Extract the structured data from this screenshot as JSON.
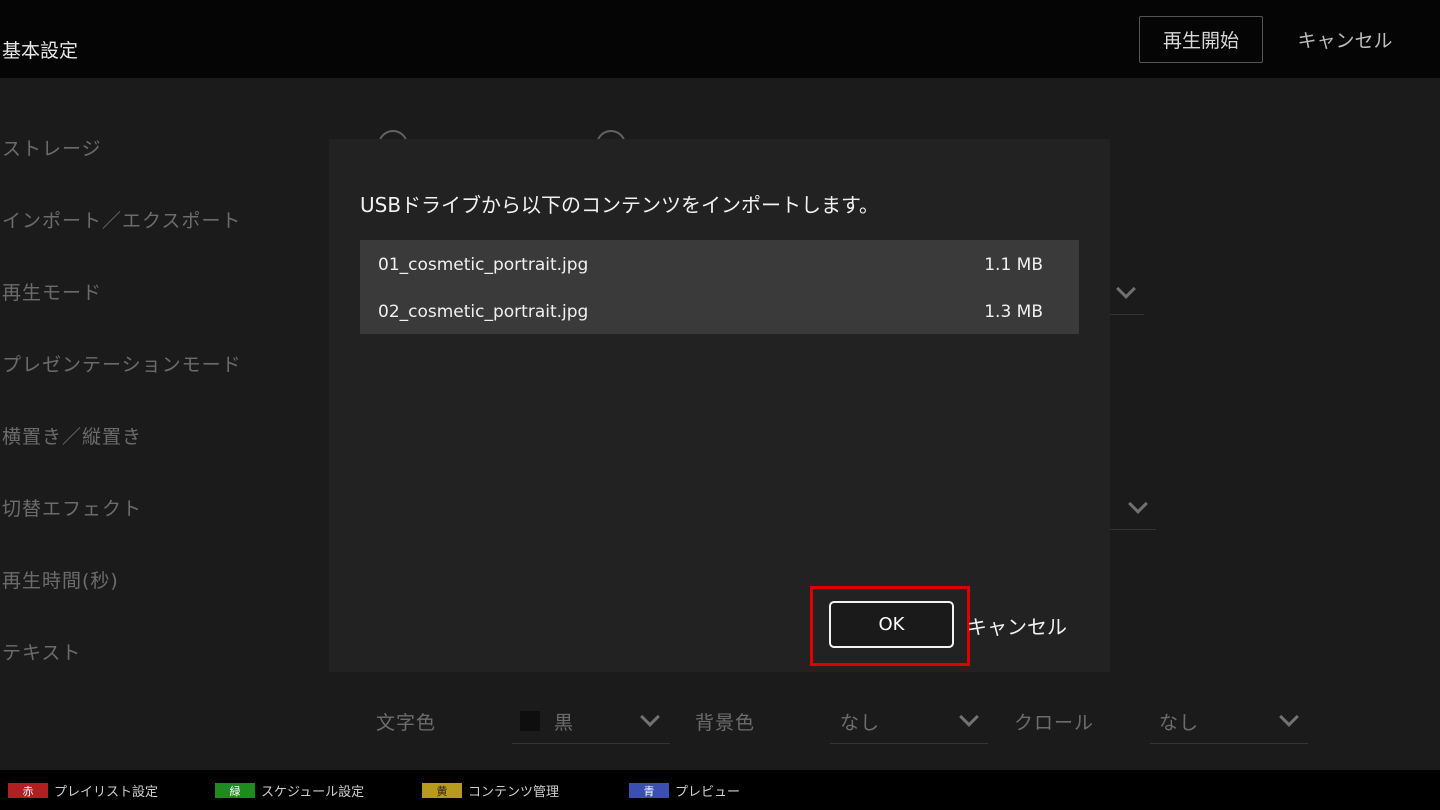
{
  "header": {
    "title": "基本設定",
    "start_label": "再生開始",
    "cancel_label": "キャンセル"
  },
  "settings": {
    "rows": [
      "ストレージ",
      "インポート／エクスポート",
      "再生モード",
      "プレゼンテーションモード",
      "横置き／縦置き",
      "切替エフェクト",
      "再生時間(秒)",
      "テキスト"
    ],
    "text_options": {
      "text_color_label": "文字色",
      "text_color_value": "黒",
      "bg_color_label": "背景色",
      "bg_color_value": "なし",
      "scroll_label": "クロール",
      "scroll_value": "なし"
    }
  },
  "dialog": {
    "message": "USBドライブから以下のコンテンツをインポートします。",
    "files": [
      {
        "name": "01_cosmetic_portrait.jpg",
        "size": "1.1 MB"
      },
      {
        "name": "02_cosmetic_portrait.jpg",
        "size": "1.3 MB"
      }
    ],
    "ok_label": "OK",
    "cancel_label": "キャンセル"
  },
  "footer": {
    "items": [
      {
        "key": "赤",
        "label": "プレイリスト設定"
      },
      {
        "key": "緑",
        "label": "スケジュール設定"
      },
      {
        "key": "黄",
        "label": "コンテンツ管理"
      },
      {
        "key": "青",
        "label": "プレビュー"
      }
    ]
  },
  "colors": {
    "highlight": "#e00000",
    "dialog_bg": "#222222",
    "list_bg": "#3a3a3a"
  }
}
